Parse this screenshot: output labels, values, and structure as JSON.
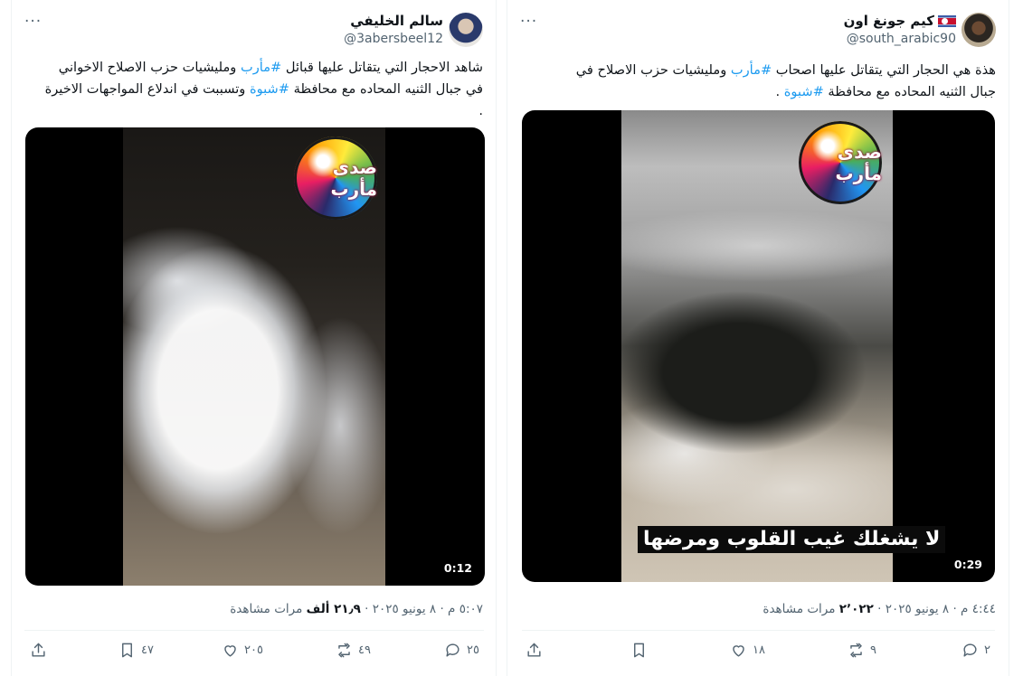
{
  "tweets": [
    {
      "author_name": "سالم الخليفي",
      "author_handle": "@3abersbeel12",
      "more_label": "···",
      "text_line1_a": "شاهد الاحجار التي يتقاتل عليها قبائل ",
      "text_line1_hashtag": "#مأرب",
      "text_line1_b": " ومليشيات حزب الاصلاح الاخواني",
      "text_line2_a": "في جبال الثنيه المحاده مع محافظة ",
      "text_line2_hashtag": "#شبوة",
      "text_line2_b": " وتسببت في اندلاع المواجهات الاخيرة",
      "text_line3": ".",
      "video_logo_text": "صدى مأرب",
      "video_duration": "0:12",
      "timestamp": "٥:٠٧ م · ٨ يونيو ٢٠٢٥ · ",
      "views_count": "٢١٫٩ ألف",
      "views_label": " مرات مشاهدة",
      "replies": "٢٥",
      "retweets": "٤٩",
      "likes": "٢٠٥",
      "bookmarks": "٤٧"
    },
    {
      "author_name": "كيم جونغ اون",
      "author_handle": "@south_arabic90",
      "more_label": "···",
      "text_line1_a": "هذة هي الحجار التي يتقاتل عليها اصحاب ",
      "text_line1_hashtag": "#مأرب",
      "text_line1_b": " ومليشيات حزب الاصلاح في",
      "text_line2_a": "جبال الثنيه المحاده مع محافظة ",
      "text_line2_hashtag": "#شبوة",
      "text_line2_b": " .",
      "video_logo_text": "صدى مأرب",
      "video_subtitle": "لا يشغلك غيب القلوب ومرضها",
      "video_duration": "0:29",
      "timestamp": "٤:٤٤ م · ٨ يونيو ٢٠٢٥ · ",
      "views_count": "٢٬٠٢٢",
      "views_label": " مرات مشاهدة",
      "replies": "٢",
      "retweets": "٩",
      "likes": "١٨",
      "bookmarks": ""
    }
  ],
  "colors": {
    "hashtag": "#1d9bf0",
    "secondary_text": "#536471",
    "primary_text": "#0f1419",
    "border": "#eff3f4"
  },
  "icons": [
    "more-icon",
    "reply-icon",
    "retweet-icon",
    "like-icon",
    "bookmark-icon",
    "share-icon",
    "flag-icon",
    "avatar"
  ]
}
